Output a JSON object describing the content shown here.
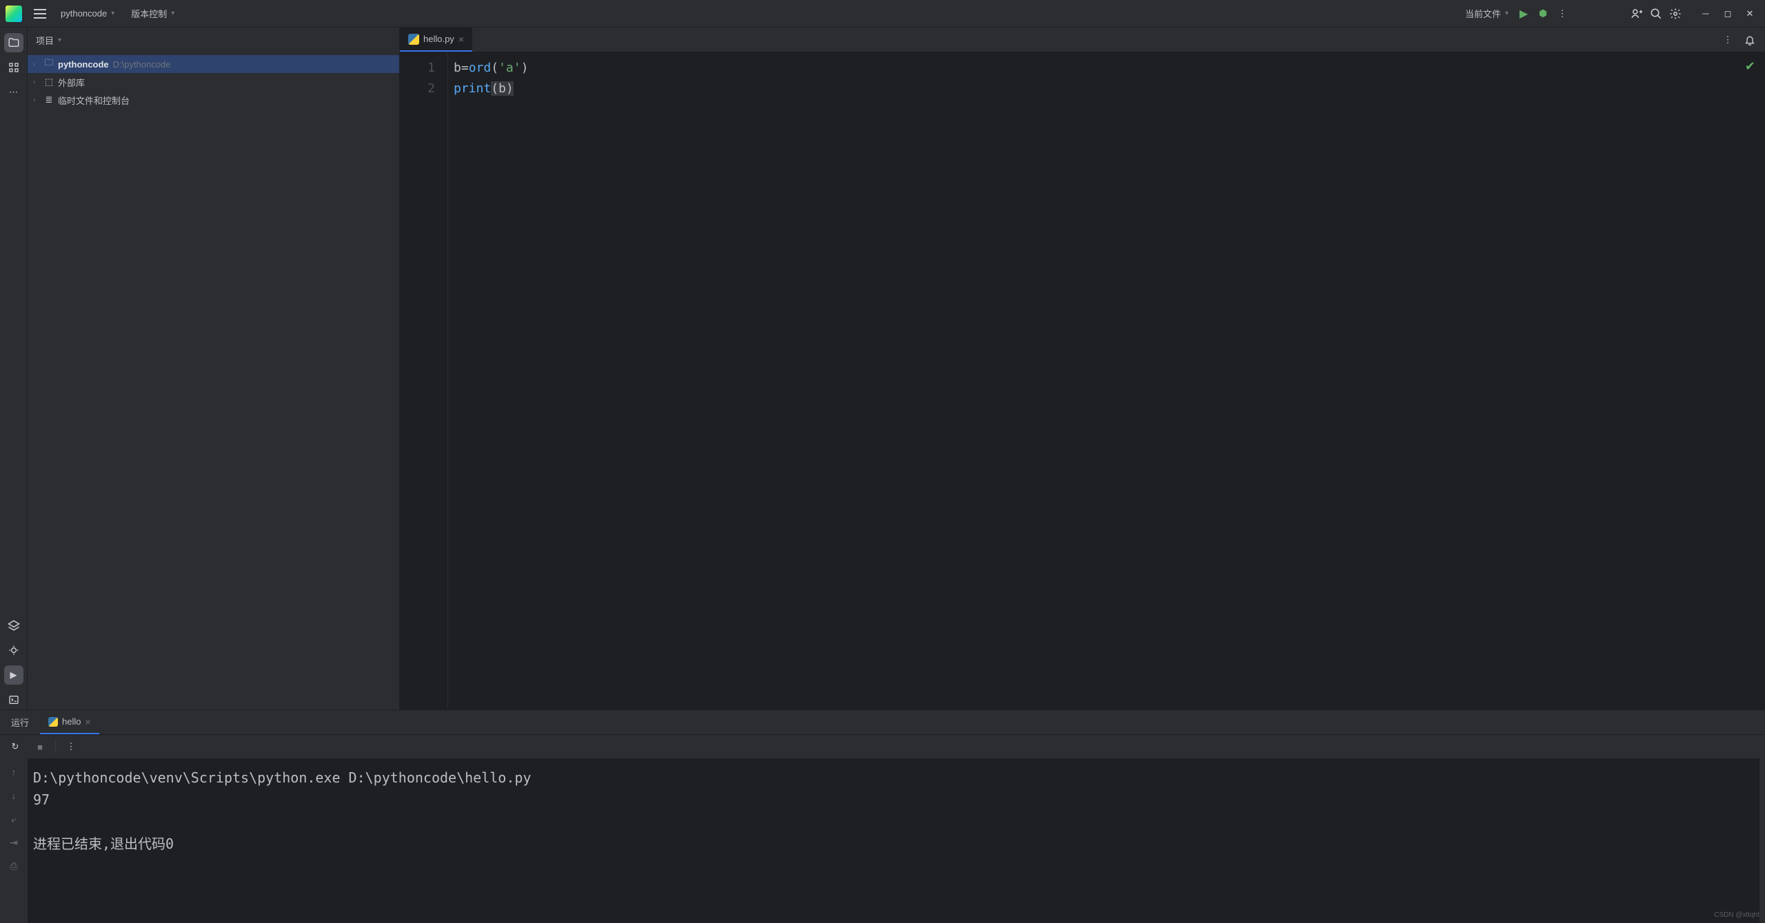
{
  "titlebar": {
    "project": "pythoncode",
    "vcs": "版本控制",
    "run_target": "当前文件"
  },
  "project_panel": {
    "title": "项目",
    "items": [
      {
        "label": "pythoncode",
        "path": "D:\\pythoncode",
        "bold": true,
        "icon": "folder",
        "selected": true
      },
      {
        "label": "外部库",
        "icon": "library"
      },
      {
        "label": "临时文件和控制台",
        "icon": "scratch"
      }
    ]
  },
  "editor": {
    "tab_name": "hello.py",
    "lines": [
      {
        "n": "1",
        "tokens": [
          {
            "t": "b",
            "c": ""
          },
          {
            "t": "=",
            "c": ""
          },
          {
            "t": "ord",
            "c": "tok-fn"
          },
          {
            "t": "(",
            "c": ""
          },
          {
            "t": "'a'",
            "c": "tok-str"
          },
          {
            "t": ")",
            "c": ""
          }
        ]
      },
      {
        "n": "2",
        "tokens": [
          {
            "t": "print",
            "c": "tok-fn"
          },
          {
            "t": "(b)",
            "c": "tok-hl"
          }
        ]
      }
    ]
  },
  "run_panel": {
    "label": "运行",
    "tab": "hello",
    "output": [
      "D:\\pythoncode\\venv\\Scripts\\python.exe D:\\pythoncode\\hello.py",
      "97",
      "",
      "进程已结束,退出代码0"
    ]
  },
  "watermark": "CSDN @xttqht"
}
